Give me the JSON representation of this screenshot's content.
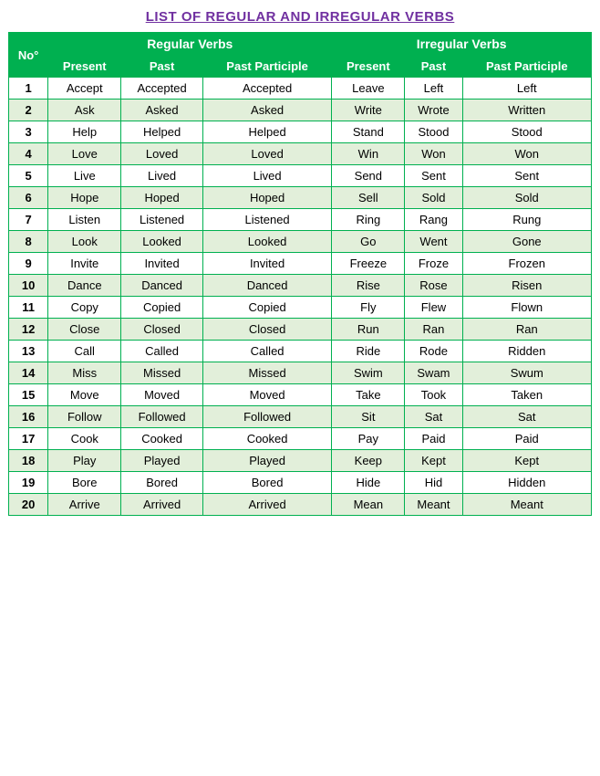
{
  "title": "LIST OF REGULAR AND IRREGULAR VERBS",
  "headers": {
    "no": "No°",
    "regularGroup": "Regular Verbs",
    "irregularGroup": "Irregular Verbs",
    "present": "Present",
    "past": "Past",
    "pastParticiple": "Past Participle"
  },
  "rows": [
    {
      "no": "1",
      "rPresent": "Accept",
      "rPast": "Accepted",
      "rPP": "Accepted",
      "iPresent": "Leave",
      "iPast": "Left",
      "iPP": "Left"
    },
    {
      "no": "2",
      "rPresent": "Ask",
      "rPast": "Asked",
      "rPP": "Asked",
      "iPresent": "Write",
      "iPast": "Wrote",
      "iPP": "Written"
    },
    {
      "no": "3",
      "rPresent": "Help",
      "rPast": "Helped",
      "rPP": "Helped",
      "iPresent": "Stand",
      "iPast": "Stood",
      "iPP": "Stood"
    },
    {
      "no": "4",
      "rPresent": "Love",
      "rPast": "Loved",
      "rPP": "Loved",
      "iPresent": "Win",
      "iPast": "Won",
      "iPP": "Won"
    },
    {
      "no": "5",
      "rPresent": "Live",
      "rPast": "Lived",
      "rPP": "Lived",
      "iPresent": "Send",
      "iPast": "Sent",
      "iPP": "Sent"
    },
    {
      "no": "6",
      "rPresent": "Hope",
      "rPast": "Hoped",
      "rPP": "Hoped",
      "iPresent": "Sell",
      "iPast": "Sold",
      "iPP": "Sold"
    },
    {
      "no": "7",
      "rPresent": "Listen",
      "rPast": "Listened",
      "rPP": "Listened",
      "iPresent": "Ring",
      "iPast": "Rang",
      "iPP": "Rung"
    },
    {
      "no": "8",
      "rPresent": "Look",
      "rPast": "Looked",
      "rPP": "Looked",
      "iPresent": "Go",
      "iPast": "Went",
      "iPP": "Gone"
    },
    {
      "no": "9",
      "rPresent": "Invite",
      "rPast": "Invited",
      "rPP": "Invited",
      "iPresent": "Freeze",
      "iPast": "Froze",
      "iPP": "Frozen"
    },
    {
      "no": "10",
      "rPresent": "Dance",
      "rPast": "Danced",
      "rPP": "Danced",
      "iPresent": "Rise",
      "iPast": "Rose",
      "iPP": "Risen"
    },
    {
      "no": "11",
      "rPresent": "Copy",
      "rPast": "Copied",
      "rPP": "Copied",
      "iPresent": "Fly",
      "iPast": "Flew",
      "iPP": "Flown"
    },
    {
      "no": "12",
      "rPresent": "Close",
      "rPast": "Closed",
      "rPP": "Closed",
      "iPresent": "Run",
      "iPast": "Ran",
      "iPP": "Ran"
    },
    {
      "no": "13",
      "rPresent": "Call",
      "rPast": "Called",
      "rPP": "Called",
      "iPresent": "Ride",
      "iPast": "Rode",
      "iPP": "Ridden"
    },
    {
      "no": "14",
      "rPresent": "Miss",
      "rPast": "Missed",
      "rPP": "Missed",
      "iPresent": "Swim",
      "iPast": "Swam",
      "iPP": "Swum"
    },
    {
      "no": "15",
      "rPresent": "Move",
      "rPast": "Moved",
      "rPP": "Moved",
      "iPresent": "Take",
      "iPast": "Took",
      "iPP": "Taken"
    },
    {
      "no": "16",
      "rPresent": "Follow",
      "rPast": "Followed",
      "rPP": "Followed",
      "iPresent": "Sit",
      "iPast": "Sat",
      "iPP": "Sat"
    },
    {
      "no": "17",
      "rPresent": "Cook",
      "rPast": "Cooked",
      "rPP": "Cooked",
      "iPresent": "Pay",
      "iPast": "Paid",
      "iPP": "Paid"
    },
    {
      "no": "18",
      "rPresent": "Play",
      "rPast": "Played",
      "rPP": "Played",
      "iPresent": "Keep",
      "iPast": "Kept",
      "iPP": "Kept"
    },
    {
      "no": "19",
      "rPresent": "Bore",
      "rPast": "Bored",
      "rPP": "Bored",
      "iPresent": "Hide",
      "iPast": "Hid",
      "iPP": "Hidden"
    },
    {
      "no": "20",
      "rPresent": "Arrive",
      "rPast": "Arrived",
      "rPP": "Arrived",
      "iPresent": "Mean",
      "iPast": "Meant",
      "iPP": "Meant"
    }
  ]
}
